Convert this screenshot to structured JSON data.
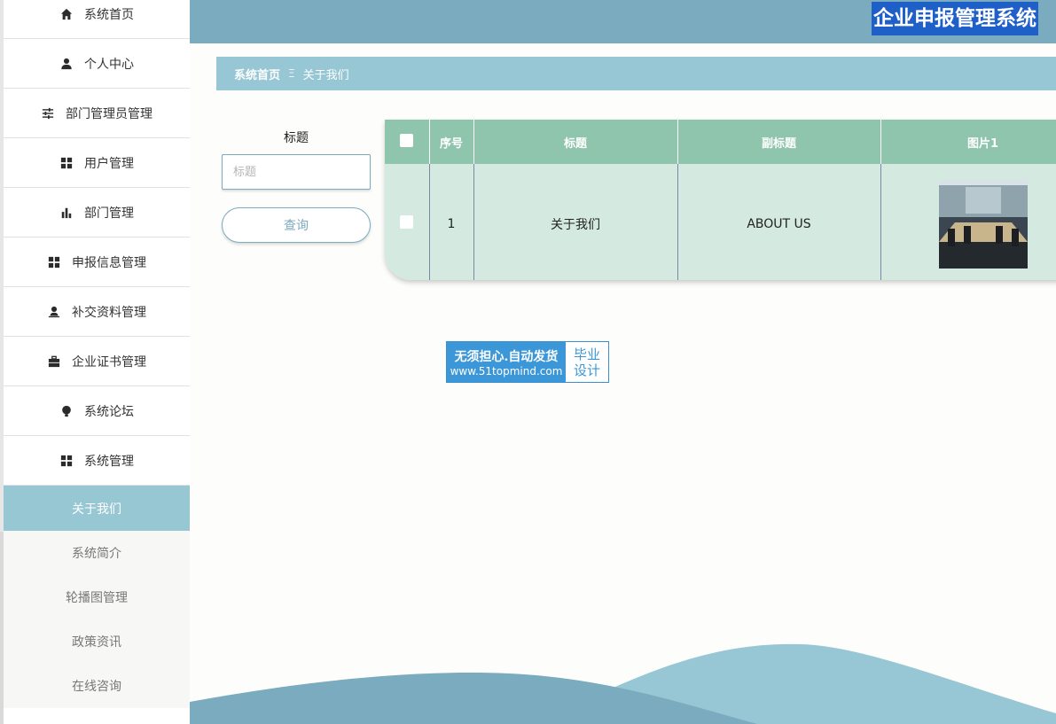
{
  "app": {
    "title": "企业申报管理系统"
  },
  "sidebar": {
    "items": [
      {
        "label": "系统首页",
        "icon": "home-icon"
      },
      {
        "label": "个人中心",
        "icon": "user-icon"
      },
      {
        "label": "部门管理员管理",
        "icon": "sliders-icon"
      },
      {
        "label": "用户管理",
        "icon": "grid-icon"
      },
      {
        "label": "部门管理",
        "icon": "bar-chart-icon"
      },
      {
        "label": "申报信息管理",
        "icon": "grid-icon"
      },
      {
        "label": "补交资料管理",
        "icon": "user-stamp-icon"
      },
      {
        "label": "企业证书管理",
        "icon": "briefcase-icon"
      },
      {
        "label": "系统论坛",
        "icon": "bulb-icon"
      },
      {
        "label": "系统管理",
        "icon": "grid-icon"
      }
    ],
    "submenu": [
      {
        "label": "关于我们",
        "active": true
      },
      {
        "label": "系统简介"
      },
      {
        "label": "轮播图管理"
      },
      {
        "label": "政策资讯"
      },
      {
        "label": "在线咨询"
      }
    ]
  },
  "breadcrumb": {
    "home": "系统首页",
    "separator": "Ξ",
    "current": "关于我们"
  },
  "search": {
    "label": "标题",
    "placeholder": "标题",
    "value": "",
    "button": "查询"
  },
  "table": {
    "columns": [
      "序号",
      "标题",
      "副标题",
      "图片1"
    ],
    "rows": [
      {
        "index": "1",
        "title": "关于我们",
        "subtitle": "ABOUT US",
        "image": "meeting-room-photo"
      }
    ]
  },
  "badge": {
    "line1": "无须担心.自动发货",
    "line2": "www.51topmind.com",
    "right1": "毕业",
    "right2": "设计"
  },
  "colors": {
    "header": "#7aabbf",
    "breadcrumb": "#97c7d5",
    "table_header": "#8fc4ad",
    "table_row": "#d4eae1",
    "active_submenu": "#97c7d3",
    "title_bg": "#1f5fc8"
  }
}
